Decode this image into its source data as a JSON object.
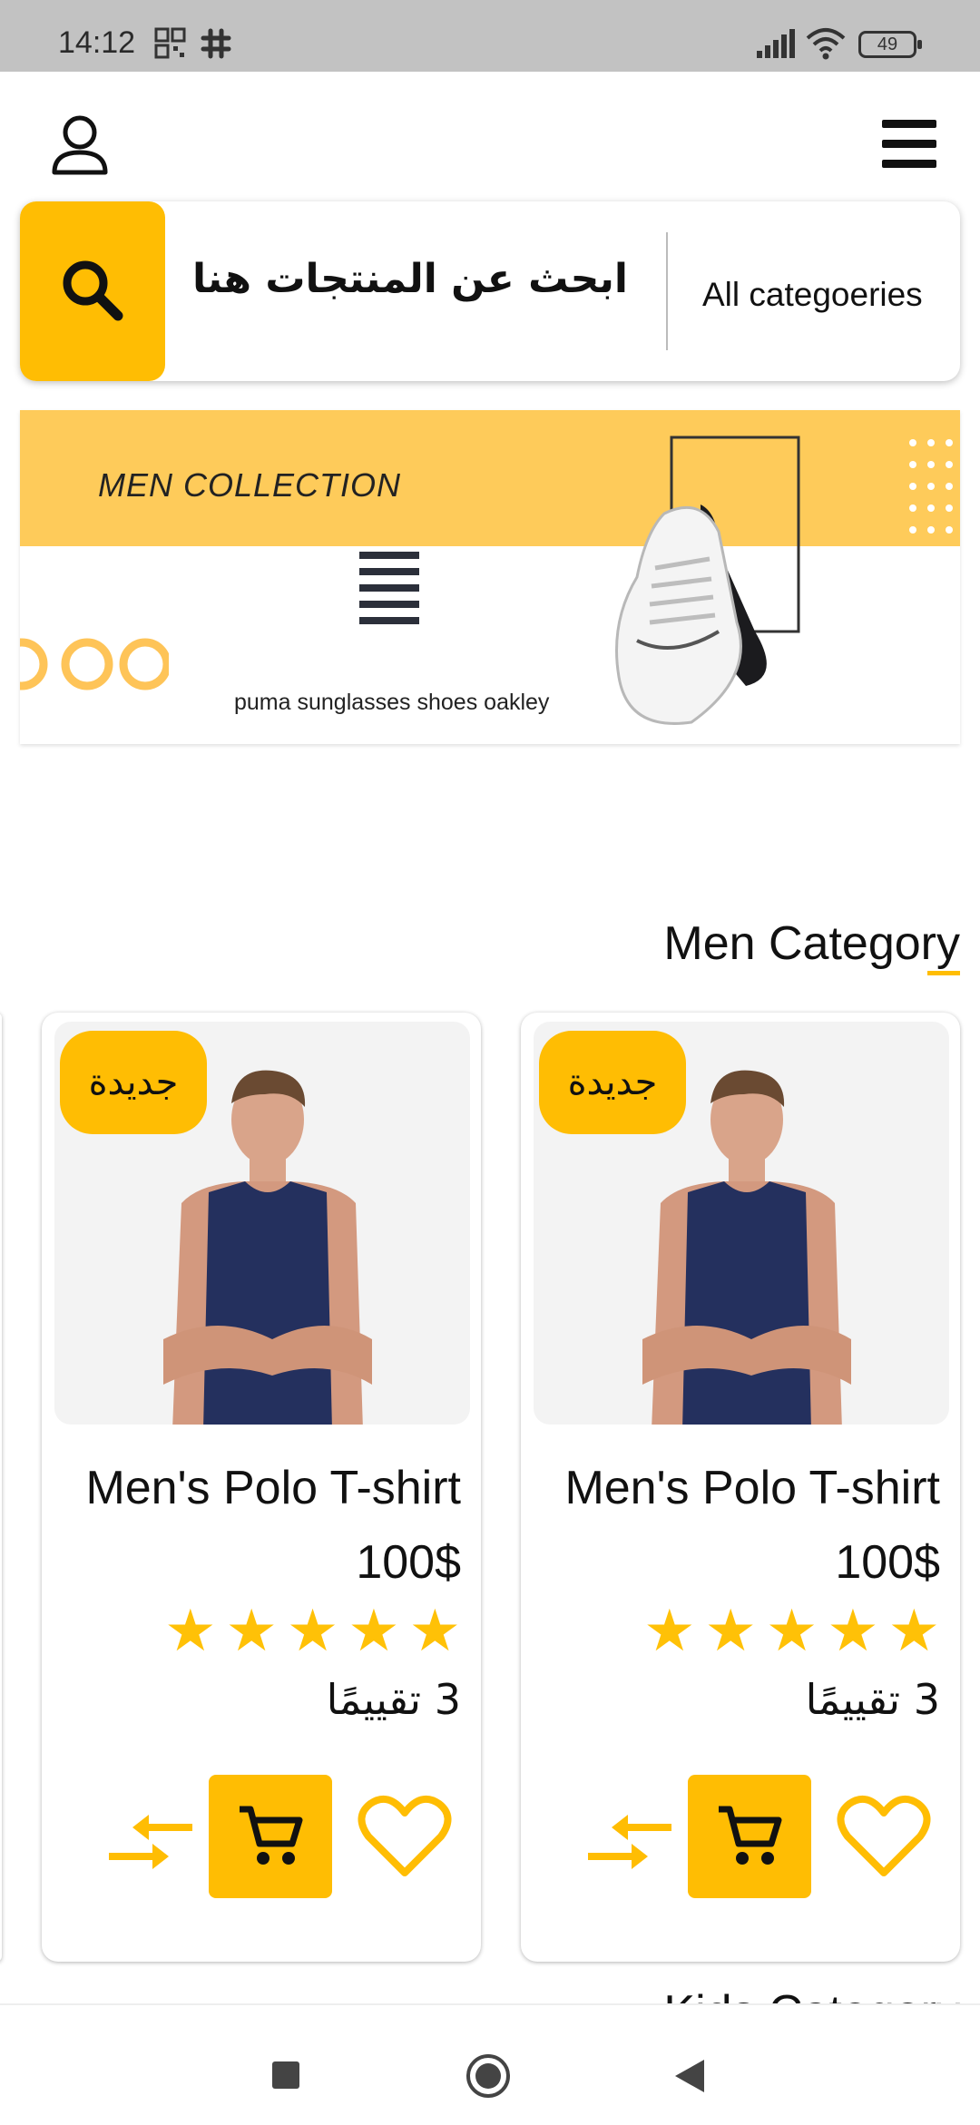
{
  "status_bar": {
    "time": "14:12",
    "battery": "49",
    "icons": [
      "qr-icon",
      "slack-icon",
      "signal-icon",
      "wifi-icon",
      "battery-icon"
    ]
  },
  "header": {
    "profile_icon": "user-icon",
    "menu_icon": "hamburger-menu-icon"
  },
  "search": {
    "placeholder": "ابحث عن المنتجات هنا",
    "category": "All categoeries",
    "button_icon": "search-icon"
  },
  "banner": {
    "title": "MEN COLLECTION",
    "subtitle": "puma sunglasses shoes oakley"
  },
  "sections": [
    {
      "title": "Men Category",
      "products": [
        {
          "badge": "جديدة",
          "name": "Men's Polo T-shirt",
          "price": "100$",
          "rating_stars": 5,
          "rating_text": "3 تقييمًا"
        },
        {
          "badge": "جديدة",
          "name": "Men's Polo T-shirt",
          "price": "100$",
          "rating_stars": 5,
          "rating_text": "3 تقييمًا"
        }
      ]
    },
    {
      "title": "Kids Category"
    }
  ],
  "colors": {
    "accent": "#ffbd03",
    "banner_yellow": "#fecb5a",
    "status_bar": "#c2c2c2"
  },
  "nav": {
    "recent": "square-icon",
    "home": "circle-icon",
    "back": "triangle-back-icon"
  }
}
